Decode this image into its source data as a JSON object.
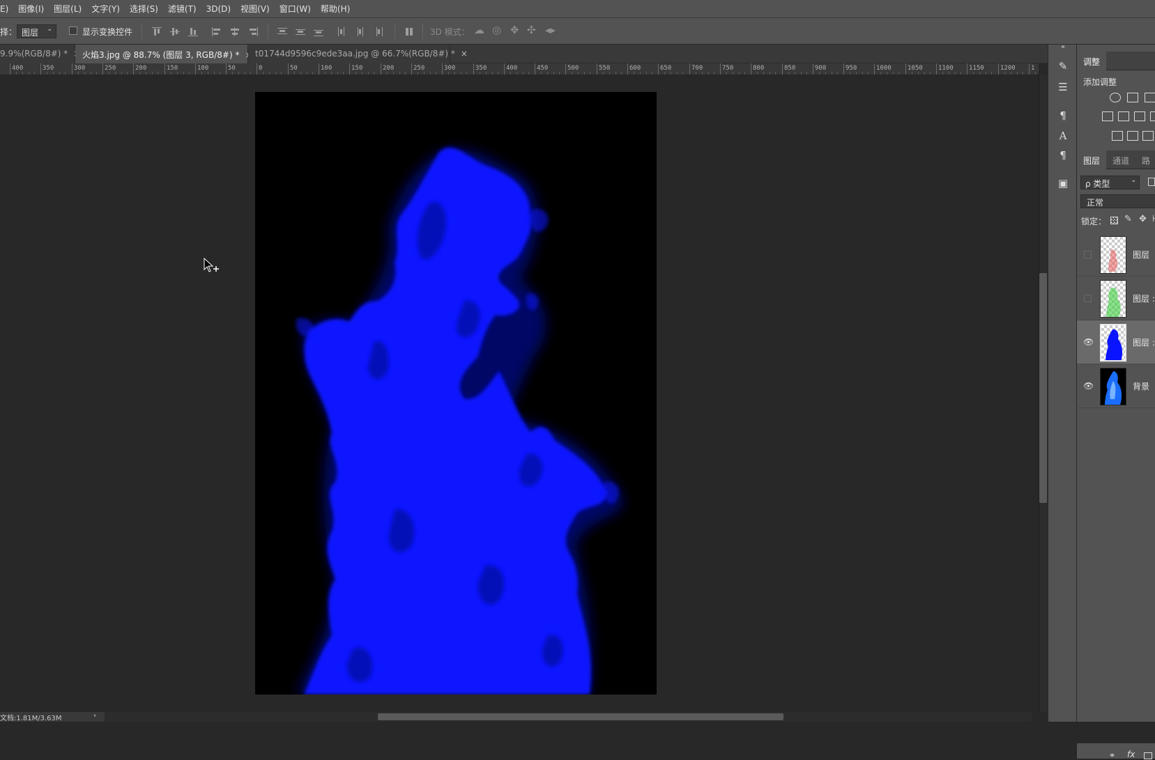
{
  "menu": [
    "E)",
    "图像(I)",
    "图层(L)",
    "文字(Y)",
    "选择(S)",
    "滤镜(T)",
    "3D(D)",
    "视图(V)",
    "窗口(W)",
    "帮助(H)"
  ],
  "options": {
    "select_label": "择：",
    "select_value": "图层",
    "show_transform_label": "显示变换控件",
    "mode_3d_label": "3D 模式："
  },
  "tabs": [
    {
      "label": "9.9%(RGB/8#) *",
      "close": "×",
      "active": false
    },
    {
      "label": "火焰3.jpg @ 88.7% (图层 3, RGB/8#) *",
      "close": "×",
      "active": true
    },
    {
      "label": "t01744d9596c9ede3aa.jpg @ 66.7%(RGB/8#) *",
      "close": "×",
      "active": false
    }
  ],
  "ruler_labels": [
    "400",
    "350",
    "300",
    "250",
    "200",
    "150",
    "100",
    "50",
    "0",
    "50",
    "100",
    "150",
    "200",
    "250",
    "300",
    "350",
    "400",
    "450",
    "500",
    "550",
    "600",
    "650",
    "700",
    "750",
    "800",
    "850",
    "900",
    "950",
    "1000",
    "1050",
    "1100",
    "1150",
    "1200",
    "1"
  ],
  "status": {
    "doc_info": "文档:1.81M/3.63M",
    "arrow": "›"
  },
  "colors": {
    "flame": "#0a14ff",
    "canvas_bg": "#000000",
    "workspace": "#282828",
    "panel": "#535353"
  },
  "panels": {
    "adjust_tab": "调整",
    "adjust_add": "添加调整",
    "layer_tabs": [
      "图层",
      "通道",
      "路"
    ],
    "filter_kind": "ρ 类型",
    "blend_mode": "正常",
    "lock_label": "锁定：",
    "layers": [
      {
        "name": "图层",
        "visible": false,
        "thumb": "red-flame",
        "selected": false
      },
      {
        "name": "图层 :",
        "visible": false,
        "thumb": "green-flame",
        "selected": false
      },
      {
        "name": "图层 :",
        "visible": true,
        "thumb": "blue-flame",
        "selected": true
      },
      {
        "name": "背景",
        "visible": true,
        "thumb": "background-flame",
        "selected": false
      }
    ],
    "footer_fx": "fx"
  }
}
